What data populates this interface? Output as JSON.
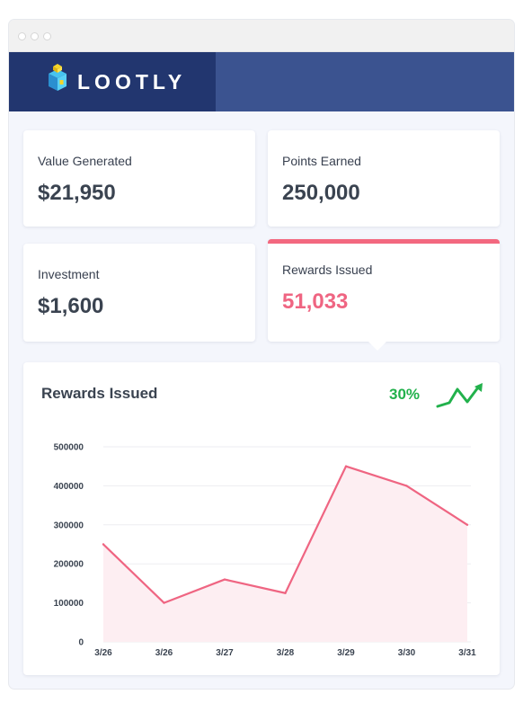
{
  "brand": {
    "name": "LOOTLY"
  },
  "stats": [
    {
      "label": "Value Generated",
      "value": "$21,950"
    },
    {
      "label": "Points Earned",
      "value": "250,000"
    },
    {
      "label": "Investment",
      "value": "$1,600"
    },
    {
      "label": "Rewards Issued",
      "value": "51,033"
    }
  ],
  "colors": {
    "header": "#3b5390",
    "brand": "#22366f",
    "accent": "#ef6582",
    "positive": "#22b14c"
  },
  "icons": {
    "logo": "treasure-chest-icon",
    "trend": "trend-up-icon"
  },
  "chart": {
    "title": "Rewards Issued",
    "change": "30%"
  },
  "chart_data": {
    "type": "area",
    "title": "Rewards Issued",
    "categories": [
      "3/26",
      "3/26",
      "3/27",
      "3/28",
      "3/29",
      "3/30",
      "3/31"
    ],
    "series": [
      {
        "values": [
          250000,
          100000,
          160000,
          125000,
          450000,
          400000,
          300000
        ]
      }
    ],
    "yticks": [
      0,
      100000,
      200000,
      300000,
      400000,
      500000
    ],
    "ylim": [
      0,
      500000
    ],
    "grid": true,
    "legend": false,
    "line_color": "#ef6582",
    "fill_color": "#fdeef2"
  }
}
